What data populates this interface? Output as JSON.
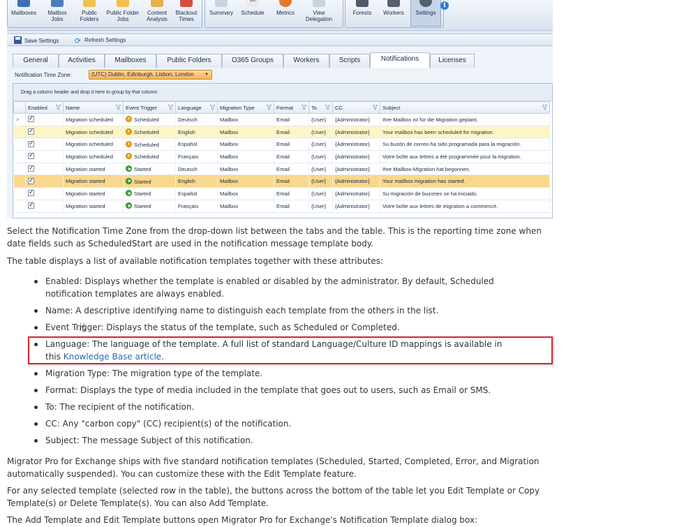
{
  "ribbon": {
    "items": [
      "Mailboxes",
      "Mailbox Jobs",
      "Public Folders",
      "Public Folder Jobs",
      "Content Analysis",
      "Blackout Times",
      "Summary",
      "Schedule",
      "Metrics",
      "View Delegation",
      "Forests",
      "Workers",
      "Settings"
    ],
    "selected": "Settings"
  },
  "toolbar": {
    "save_label": "Save Settings",
    "refresh_label": "Refresh Settings"
  },
  "tabs": [
    "General",
    "Activities",
    "Mailboxes",
    "Public Folders",
    "O365 Groups",
    "Workers",
    "Scripts",
    "Notifications",
    "Licenses"
  ],
  "active_tab": "Notifications",
  "timezone": {
    "label": "Notification Time Zone:",
    "value": "(UTC) Dublin, Edinburgh, Lisbon, London"
  },
  "grid": {
    "group_hint": "Drag a column header and drop it here to group by that column",
    "columns": [
      "Enabled",
      "Name",
      "Event Trigger",
      "Language",
      "Migration Type",
      "Format",
      "To",
      "CC",
      "Subject"
    ],
    "rows": [
      {
        "name": "Migration scheduled",
        "trigger": "Scheduled",
        "language": "Deutsch",
        "type": "Mailbox",
        "format": "Email",
        "to": "{User}",
        "cc": "{Administrator}",
        "subject": "Ihre Mailbox ist für die Migration geplant."
      },
      {
        "name": "Migration scheduled",
        "trigger": "Scheduled",
        "language": "English",
        "type": "Mailbox",
        "format": "Email",
        "to": "{User}",
        "cc": "{Administrator}",
        "subject": "Your mailbox has been scheduled for migration."
      },
      {
        "name": "Migration scheduled",
        "trigger": "Scheduled",
        "language": "Español",
        "type": "Mailbox",
        "format": "Email",
        "to": "{User}",
        "cc": "{Administrator}",
        "subject": "Su buzón de correo ha sido programada para la migración."
      },
      {
        "name": "Migration scheduled",
        "trigger": "Scheduled",
        "language": "Français",
        "type": "Mailbox",
        "format": "Email",
        "to": "{User}",
        "cc": "{Administrator}",
        "subject": "Votre boîte aux lettres a été programmée pour la migration."
      },
      {
        "name": "Migration started",
        "trigger": "Started",
        "language": "Deutsch",
        "type": "Mailbox",
        "format": "Email",
        "to": "{User}",
        "cc": "{Administrator}",
        "subject": "Ihre Mailbox-Migration hat begonnen."
      },
      {
        "name": "Migration started",
        "trigger": "Started",
        "language": "English",
        "type": "Mailbox",
        "format": "Email",
        "to": "{User}",
        "cc": "{Administrator}",
        "subject": "Your mailbox migration has started."
      },
      {
        "name": "Migration started",
        "trigger": "Started",
        "language": "Español",
        "type": "Mailbox",
        "format": "Email",
        "to": "{User}",
        "cc": "{Administrator}",
        "subject": "Su migración de buzones se ha iniciado."
      },
      {
        "name": "Migration started",
        "trigger": "Started",
        "language": "Français",
        "type": "Mailbox",
        "format": "Email",
        "to": "{User}",
        "cc": "{Administrator}",
        "subject": "Votre boîte aux lettres de migration a commencé."
      }
    ]
  },
  "doc": {
    "p1": "Select the Notification Time Zone from the drop-down list between the tabs and the table. This is the reporting time zone when date fields such as ScheduledStart are used in the notification message template body.",
    "p2": "The table displays a list of available notification templates together with these attributes:",
    "bullets": [
      "Enabled: Displays whether the template is enabled or disabled by the administrator. By default, Scheduled notification templates are always enabled.",
      "Name: A descriptive identifying name to distinguish each template from the others in the list.",
      "Event Trigger: Displays the status of the template, such as Scheduled or Completed.",
      "Language: The language of the template. A full list of standard Language/Culture ID mappings is available in this ",
      "Migration Type: The migration type of the template.",
      "Format: Displays the type of media included in the template that goes out to users, such as Email or SMS.",
      "To: The recipient of the notification.",
      "CC: Any \"carbon copy\" (CC) recipient(s) of the notification.",
      "Subject: The message Subject of this notification."
    ],
    "kb_link": "Knowledge Base article",
    "kb_suffix": ".",
    "p3": "Migrator Pro for Exchange ships with five standard notification templates (Scheduled, Started, Completed, Error, and Migration automatically suspended). You can customize these with the Edit Template feature.",
    "p4": "For any selected template (selected row in the table), the buttons across the bottom of the table let you Edit Template or Copy Template(s) or Delete Template(s). You can also Add Template.",
    "p5": "The Add Template and Edit Template buttons open Migrator Pro for Exchange's Notification Template dialog box:"
  }
}
